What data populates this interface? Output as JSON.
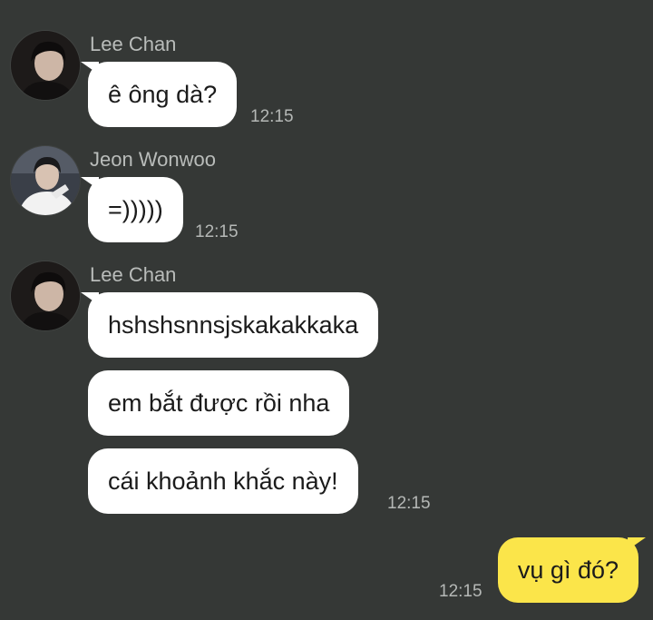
{
  "chat": {
    "groups": [
      {
        "sender": "Lee Chan",
        "messages": [
          "ê ông dà?"
        ],
        "time": "12:15"
      },
      {
        "sender": "Jeon Wonwoo",
        "messages": [
          "=)))))"
        ],
        "time": "12:15"
      },
      {
        "sender": "Lee Chan",
        "messages": [
          "hshshsnnsjskakakkaka",
          "em bắt được rồi nha",
          "cái khoảnh khắc này!"
        ],
        "time": "12:15"
      }
    ],
    "outgoing": {
      "message": "vụ gì đó?",
      "time": "12:15"
    }
  },
  "colors": {
    "background": "#353836",
    "incoming_bubble": "#ffffff",
    "outgoing_bubble": "#fbe54a",
    "sender_text": "#b9bcba",
    "time_text": "#b5b8b6"
  }
}
